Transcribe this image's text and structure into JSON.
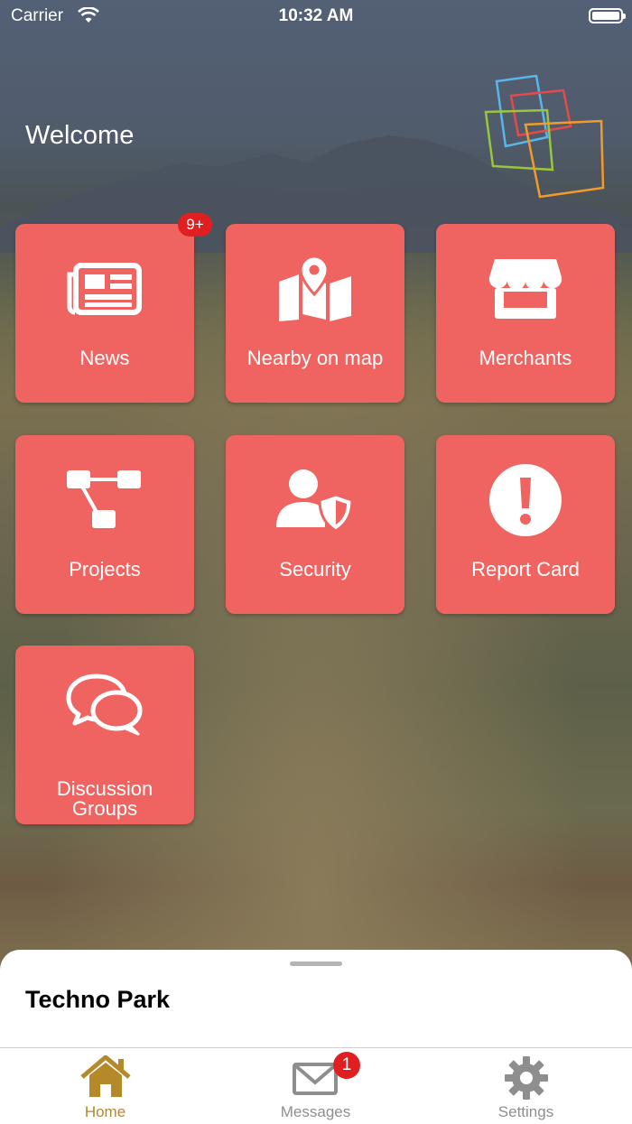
{
  "status_bar": {
    "carrier": "Carrier",
    "time": "10:32 AM"
  },
  "header": {
    "welcome": "Welcome"
  },
  "tiles": [
    {
      "label": "News",
      "icon": "newspaper-icon",
      "badge": "9+"
    },
    {
      "label": "Nearby on map",
      "icon": "map-pin-icon"
    },
    {
      "label": "Merchants",
      "icon": "storefront-icon"
    },
    {
      "label": "Projects",
      "icon": "sitemap-icon"
    },
    {
      "label": "Security",
      "icon": "user-shield-icon"
    },
    {
      "label": "Report Card",
      "icon": "exclamation-circle-icon"
    },
    {
      "label_line1": "Discussion",
      "label_line2": "Groups",
      "icon": "chat-bubbles-icon"
    }
  ],
  "sheet": {
    "title": "Techno Park"
  },
  "tabbar": {
    "home": {
      "label": "Home",
      "icon": "home-icon",
      "active_color": "#b5882a"
    },
    "messages": {
      "label": "Messages",
      "icon": "envelope-icon",
      "badge": "1"
    },
    "settings": {
      "label": "Settings",
      "icon": "gear-icon"
    }
  },
  "colors": {
    "tile": "#ef6461",
    "badge": "#e02020",
    "active_tab": "#b5882a",
    "inactive_tab": "#8e8e8e"
  }
}
